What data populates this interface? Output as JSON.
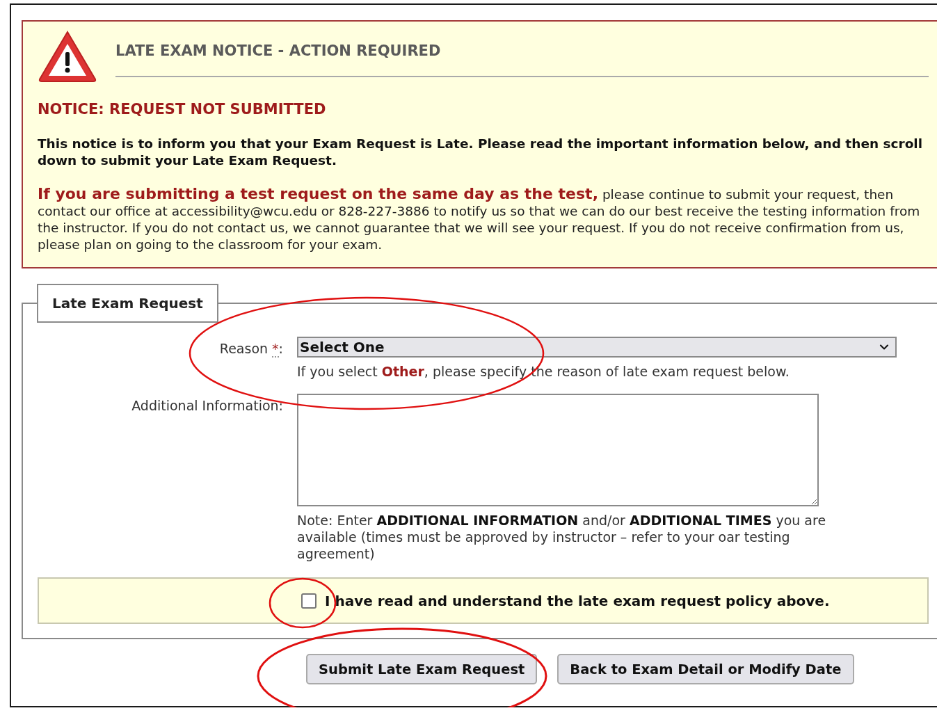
{
  "notice": {
    "title": "LATE EXAM NOTICE - ACTION REQUIRED",
    "heading": "NOTICE: REQUEST NOT SUBMITTED",
    "intro": "This notice is to inform you that your Exam Request is Late. Please read the important information below, and then scroll down to submit your Late Exam Request.",
    "warning": "**If you are submitting a test request on the same day as the test,** please continue to submit your request, then contact our office at accessibility@wcu.edu or 828-227-3886 to notify us so that we can do our best receive the testing information from the instructor. If you do not contact us, we cannot guarantee that we will see your request. If you do not receive confirmation from us, please plan on going to the classroom for your exam."
  },
  "form": {
    "legend": "Late Exam Request",
    "fields": [
      {
        "kind": "select",
        "label": "Reason",
        "required_mark": "*",
        "colon": ":",
        "value": "Select One",
        "help": "If you select **Other**, please specify the reason of late exam request below."
      },
      {
        "kind": "textarea",
        "label": "Additional Information:",
        "help": "Note: Enter **ADDITIONAL INFORMATION** and/or **ADDITIONAL TIMES** you are available (times must be approved by instructor – refer to your oar testing agreement)"
      }
    ],
    "agreement": {
      "label": "I have read and understand the late exam request policy above.",
      "checked": false
    }
  },
  "buttons": [
    {
      "label": "Submit Late Exam Request"
    },
    {
      "label": "Back to Exam Detail or Modify Date"
    }
  ]
}
